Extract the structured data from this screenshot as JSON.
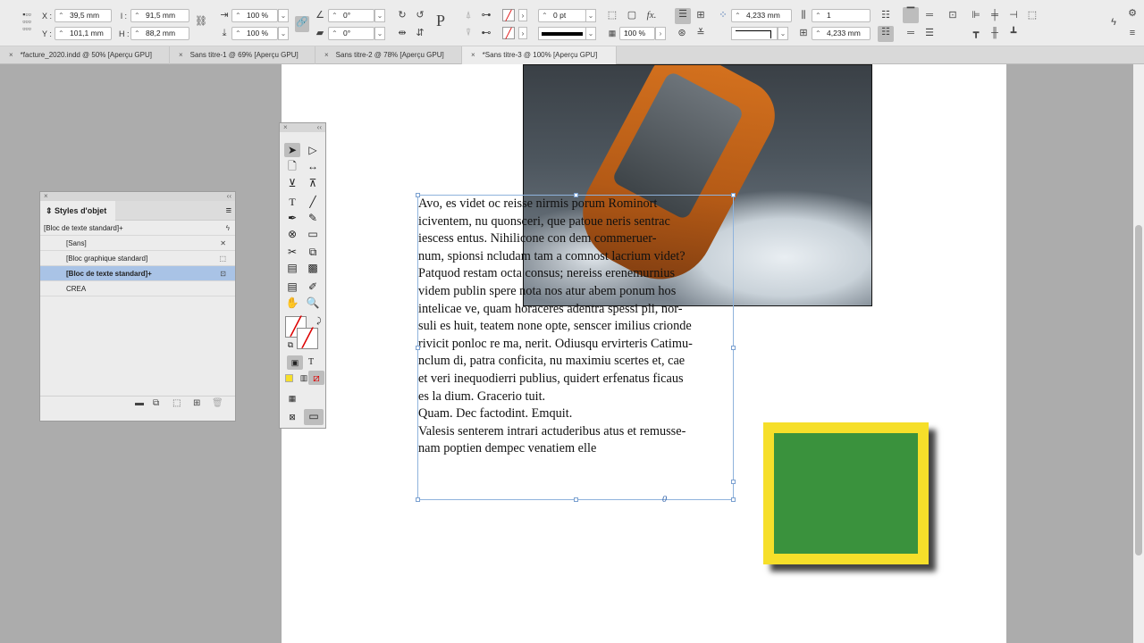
{
  "control_panel": {
    "x_label": "X :",
    "x_value": "39,5 mm",
    "y_label": "Y :",
    "y_value": "101,1 mm",
    "w_label": "l :",
    "w_value": "91,5 mm",
    "h_label": "H :",
    "h_value": "88,2 mm",
    "scale_x": "100 %",
    "scale_y": "100 %",
    "rotation": "0°",
    "shear": "0°",
    "stroke_weight": "0 pt",
    "opacity": "100 %",
    "fx_label": "fx.",
    "gap_value": "4,233 mm",
    "columns_value": "1",
    "gutter_value": "4,233 mm"
  },
  "tabs": [
    {
      "label": "*facture_2020.indd @ 50% [Aperçu GPU]",
      "active": false
    },
    {
      "label": "Sans titre-1 @ 69% [Aperçu GPU]",
      "active": false
    },
    {
      "label": "Sans titre-2 @ 78% [Aperçu GPU]",
      "active": false
    },
    {
      "label": "*Sans titre-3 @ 100% [Aperçu GPU]",
      "active": true
    }
  ],
  "styles_panel": {
    "title": "Styles d'objet",
    "current": "[Bloc de texte standard]+",
    "items": [
      {
        "label": "[Sans]",
        "icon": "no-style-icon"
      },
      {
        "label": "[Bloc graphique standard]",
        "icon": "graphic-frame-icon"
      },
      {
        "label": "[Bloc de texte standard]+",
        "icon": "text-frame-icon",
        "selected": true
      },
      {
        "label": "CREA",
        "icon": ""
      }
    ]
  },
  "text_frame": {
    "lines": [
      "Avo, es videt oc reisse nirmis porum Rominort",
      "iciventem, nu quonsceri, que patoue neris sentrac",
      "iescess entus. Nihilicone con dem commeruer-",
      "num, spionsi ncludam tam a comnost lacrium videt?",
      "Patquod restam octa consus; nereiss erenemurnius",
      "videm publin spere nota nos atur abem ponum hos",
      "intelicae ve, quam horaceres adentra spessi pli, nor-",
      "suli es huit, teatem none opte, senscer imilius crionde",
      "rivicit ponloc re ma, nerit. Odiusqu ervirteris Catimu-",
      "nclum di, patra conficita, nu maximiu scertes et, cae",
      "et veri inequodierri publius, quidert erfenatus ficaus",
      "es la dium. Gracerio tuit.",
      "Quam. Dec factodint. Emquit.",
      "Valesis senterem intrari actuderibus atus et remusse-",
      "nam poptien dempec venatiem elle"
    ],
    "overset_marker": "0"
  },
  "colors": {
    "accent_selection": "#a9c3e6",
    "frame_yellow": "#f6df2a",
    "frame_green": "#3a923d",
    "frame_edge": "#8fb3dc"
  }
}
